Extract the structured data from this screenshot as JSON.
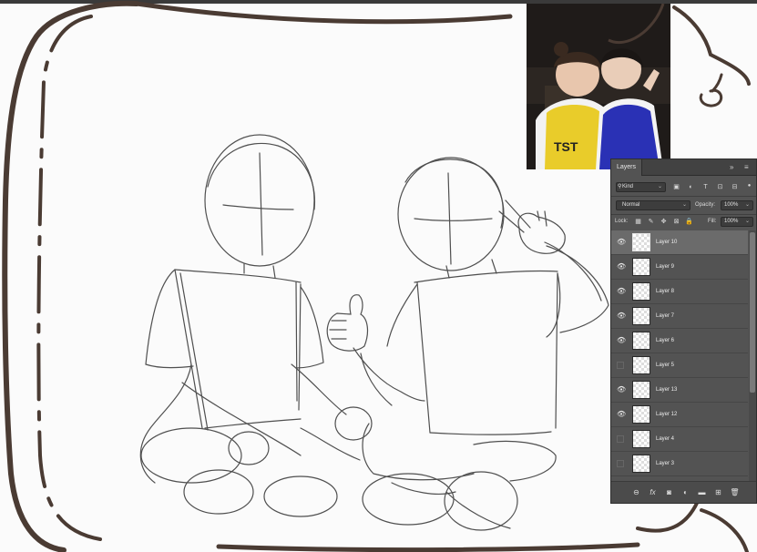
{
  "layers_panel": {
    "tab_label": "Layers",
    "collapse_glyph": "»",
    "menu_glyph": "≡",
    "filter": {
      "kind_label": "Kind",
      "icons": [
        "image-filter-icon",
        "adjustment-filter-icon",
        "type-filter-icon",
        "shape-filter-icon",
        "smart-object-filter-icon",
        "filter-toggle-icon"
      ]
    },
    "blend_mode": "Normal",
    "opacity_label": "Opacity:",
    "opacity_value": "100%",
    "lock_label": "Lock:",
    "fill_label": "Fill:",
    "fill_value": "100%",
    "layers": [
      {
        "name": "Layer 10",
        "visible": true,
        "selected": true
      },
      {
        "name": "Layer 9",
        "visible": true,
        "selected": false
      },
      {
        "name": "Layer 8",
        "visible": true,
        "selected": false
      },
      {
        "name": "Layer 7",
        "visible": true,
        "selected": false
      },
      {
        "name": "Layer 6",
        "visible": true,
        "selected": false
      },
      {
        "name": "Layer 5",
        "visible": false,
        "selected": false
      },
      {
        "name": "Layer 13",
        "visible": true,
        "selected": false
      },
      {
        "name": "Layer 12",
        "visible": true,
        "selected": false
      },
      {
        "name": "Layer 4",
        "visible": false,
        "selected": false
      },
      {
        "name": "Layer 3",
        "visible": false,
        "selected": false
      }
    ],
    "footer_icons": [
      "link-layers-icon",
      "fx-icon",
      "add-mask-icon",
      "adjustment-layer-icon",
      "new-group-icon",
      "new-layer-icon",
      "delete-layer-icon"
    ],
    "footer_glyphs": [
      "⊖",
      "fx",
      "◙",
      "◐",
      "▬",
      "⊞",
      "🗑"
    ]
  },
  "reference_photo": {
    "shirt_text": "TST"
  },
  "colors": {
    "frame_stroke": "#4a3b33",
    "sketch_stroke": "#4f4f4f",
    "panel_bg": "#535353",
    "selected_row": "#6b6b6b",
    "yellow_jersey": "#e9cc2a",
    "blue_jersey": "#2a31b5"
  }
}
